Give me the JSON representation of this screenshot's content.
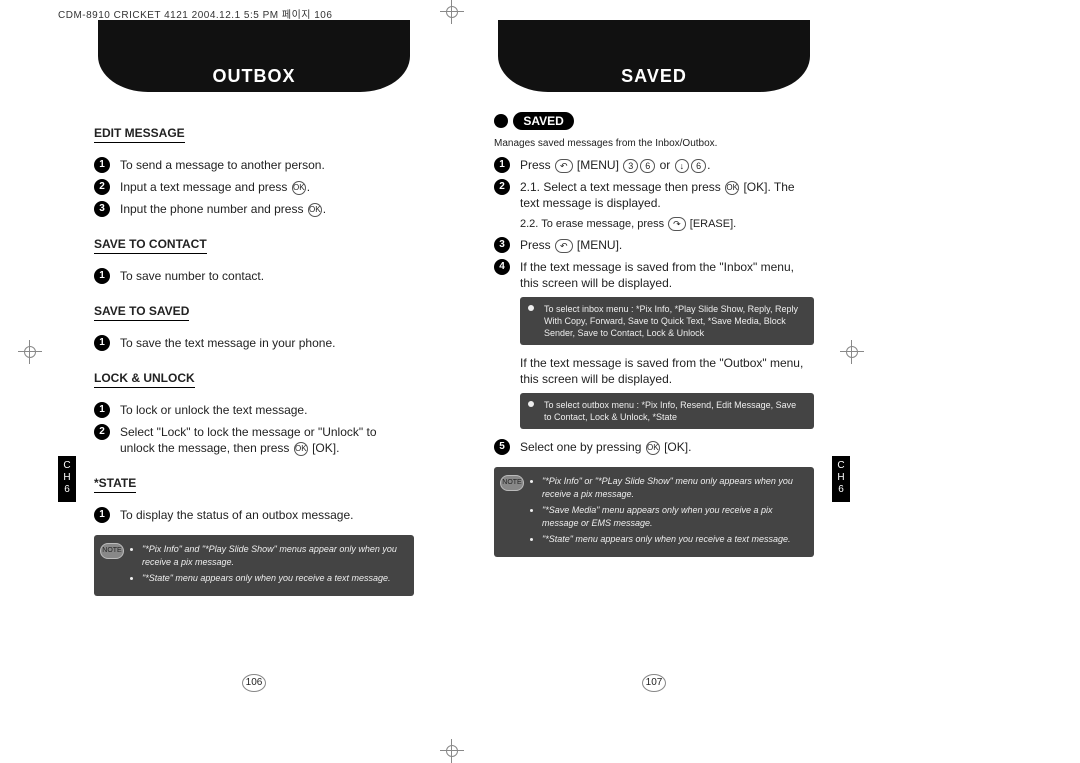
{
  "meta": {
    "topstrip": "CDM-8910 CRICKET 4121  2004.12.1  5:5 PM  페이지 106"
  },
  "left": {
    "header": "OUTBOX",
    "sidebar": "C\nH\n6",
    "sections": {
      "edit": {
        "title": "EDIT MESSAGE",
        "s1": "To send a message to another person.",
        "s2a": "Input a text message and press ",
        "s2b": ".",
        "s3a": "Input the phone number and press ",
        "s3b": "."
      },
      "contact": {
        "title": "SAVE TO CONTACT",
        "s1": "To save number to contact."
      },
      "saved": {
        "title": "SAVE TO SAVED",
        "s1": "To save the text message in your phone."
      },
      "lock": {
        "title": "LOCK & UNLOCK",
        "s1": "To lock or unlock the text message.",
        "s2a": "Select \"Lock\" to lock the message or \"Unlock\" to unlock the message, then press ",
        "s2b": " [OK]."
      },
      "state": {
        "title": "*STATE",
        "s1": "To display the status of an outbox message."
      }
    },
    "note": {
      "badge": "NOTE",
      "n1": "\"*Pix Info\" and \"*Play Slide Show\" menus appear only when you receive a pix message.",
      "n2": "\"*State\" menu appears only when you receive a text message."
    },
    "pagenum": "106"
  },
  "right": {
    "header": "SAVED",
    "pill": "SAVED",
    "subtitle": "Manages saved messages from the Inbox/Outbox.",
    "sidebar": "C\nH\n6",
    "steps": {
      "s1a": "Press ",
      "s1b": " [MENU] ",
      "s1c": " or ",
      "s1d": ".",
      "s2_1a": "2.1. Select a text message then press ",
      "s2_1b": " [OK]. The text message is displayed.",
      "s2_2a": "2.2. To erase message, press ",
      "s2_2b": " [ERASE].",
      "s3a": "Press ",
      "s3b": " [MENU].",
      "s4": "If the text message is saved from the \"Inbox\" menu, this screen will be displayed.",
      "info_inbox": "To select inbox menu : *Pix Info, *Play Slide Show, Reply, Reply With Copy, Forward, Save to Quick Text, *Save Media, Block Sender, Save to Contact, Lock & Unlock",
      "mid": "If the text message is saved from the \"Outbox\" menu, this screen will be displayed.",
      "info_outbox": "To select outbox menu : *Pix Info, Resend, Edit Message, Save to Contact, Lock & Unlock, *State",
      "s5a": "Select one by pressing ",
      "s5b": " [OK]."
    },
    "note": {
      "badge": "NOTE",
      "n1": "\"*Pix Info\" or \"*PLay Slide Show\" menu only appears when you receive a pix message.",
      "n2": "\"*Save Media\" menu appears only when you receive a pix message or EMS message.",
      "n3": "\"*State\" menu appears only when you receive a text message."
    },
    "pagenum": "107"
  },
  "keys": {
    "ok": "OK",
    "left": "↶",
    "right": "↷",
    "three": "3",
    "six": "6",
    "down": "↓"
  }
}
